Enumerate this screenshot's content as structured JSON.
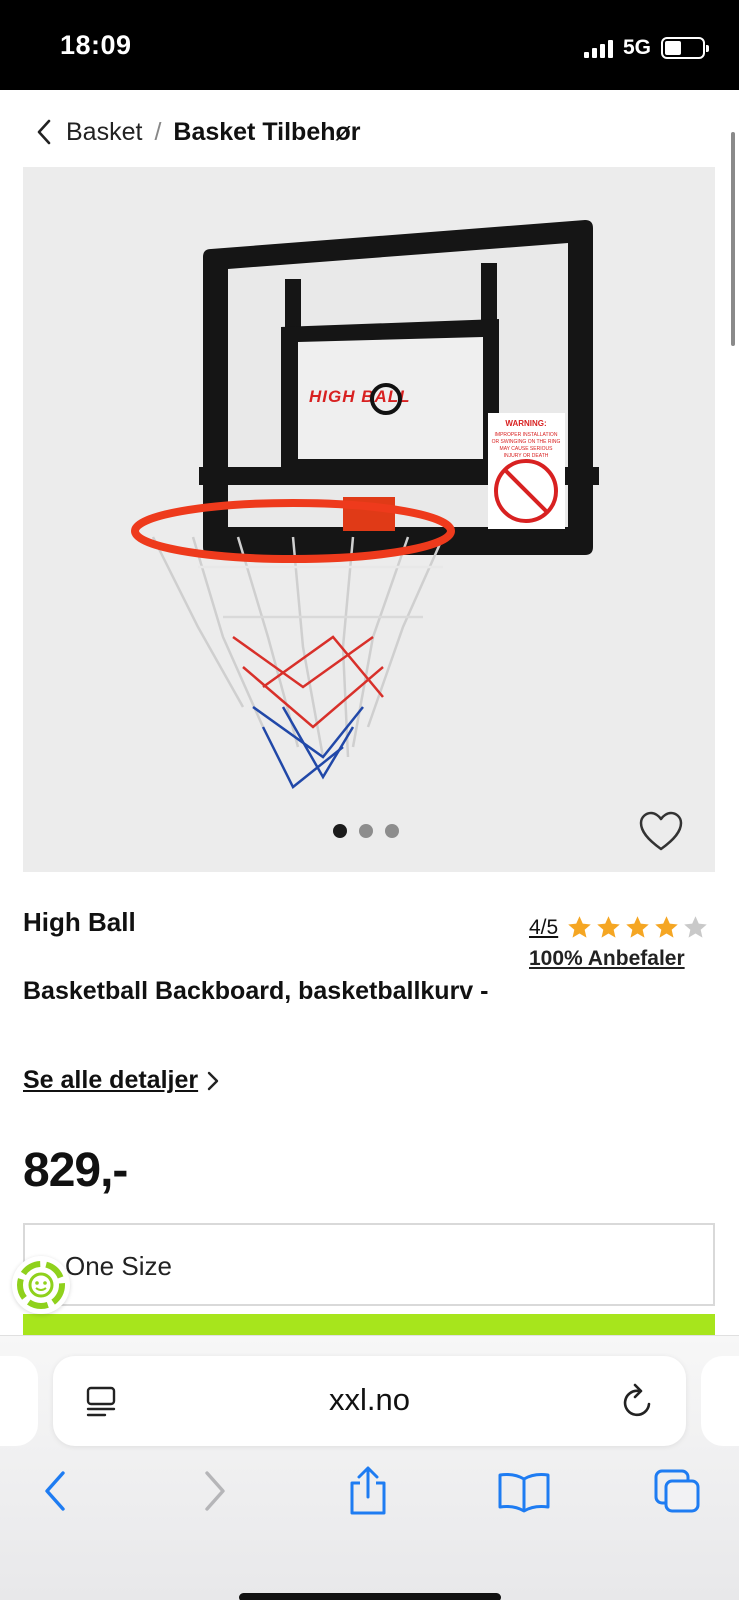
{
  "status_bar": {
    "time": "18:09",
    "network": "5G",
    "battery_level": 0.45
  },
  "breadcrumb": {
    "parent": "Basket",
    "separator": "/",
    "current": "Basket Tilbehør"
  },
  "product_image": {
    "backboard_logo": "HIGH BALL",
    "warning_sticker": "WARNING: IMPROPER INSTALLATION OR SWINGING ON THE RING MAY CAUSE SERIOUS INJURY OR DEATH",
    "carousel_total": 3,
    "carousel_active": 1,
    "wishlist_icon": "heart-outline-icon"
  },
  "product": {
    "brand": "High Ball",
    "rating_text": "4/5",
    "rating_value": 4,
    "rating_max": 5,
    "recommend": "100% Anbefaler",
    "title": "Basketball Backboard, basketballkurv -",
    "details_link": "Se alle detaljer",
    "price": "829,-",
    "size": "One Size"
  },
  "browser": {
    "url": "xxl.no",
    "icons": [
      "reader-icon",
      "reload-icon",
      "back-icon",
      "forward-icon",
      "share-icon",
      "bookmarks-icon",
      "tabs-icon"
    ]
  },
  "colors": {
    "accent_green": "#a7e51c",
    "star": "#f5a623",
    "ios_blue": "#1e7cf2",
    "rim_red": "#ee3a1c"
  }
}
